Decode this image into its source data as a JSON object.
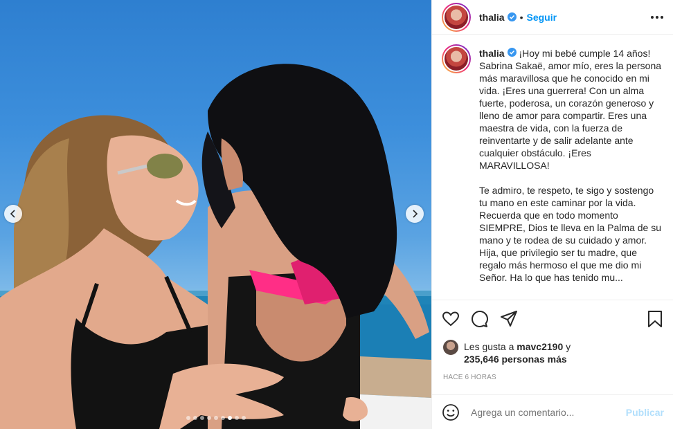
{
  "post": {
    "username": "thalia",
    "follow_label": "Seguir",
    "separator": "•",
    "caption_first": "¡Hoy mi bebé cumple 14 años!",
    "caption_body": "Sabrina Sakaë, amor mío, eres la persona más maravillosa que he conocido en mi vida. ¡Eres una guerrera! Con un alma fuerte, poderosa, un corazón generoso y lleno de amor para compartir. Eres una maestra de vida, con la fuerza de reinventarte y de salir adelante ante cualquier obstáculo. ¡Eres MARAVILLOSA!\n\nTe admiro, te respeto, te sigo y sostengo tu mano en este caminar por la vida. Recuerda que en todo momento SIEMPRE, Dios te lleva en la Palma de su mano y te rodea de su cuidado y amor. Hija, que privilegio ser tu madre, que regalo más hermoso el que me dio mi Señor. Ha lo que has tenido mu..."
  },
  "likes": {
    "prefix": "Les gusta a ",
    "user": "mavc2190",
    "conj": " y",
    "count": "235,646 personas más"
  },
  "timestamp": "HACE 6 HORAS",
  "comment": {
    "placeholder": "Agrega un comentario...",
    "publish_label": "Publicar"
  },
  "carousel": {
    "total": 9,
    "active_index": 6
  },
  "colors": {
    "link": "#0095f6",
    "publish_disabled": "#b2dffc",
    "verified": "#3897f0",
    "muted": "#8e8e8e"
  },
  "icons": [
    "heart-icon",
    "comment-icon",
    "share-icon",
    "bookmark-icon",
    "emoji-icon",
    "verified-icon",
    "more-icon",
    "chevron-left-icon",
    "chevron-right-icon"
  ]
}
